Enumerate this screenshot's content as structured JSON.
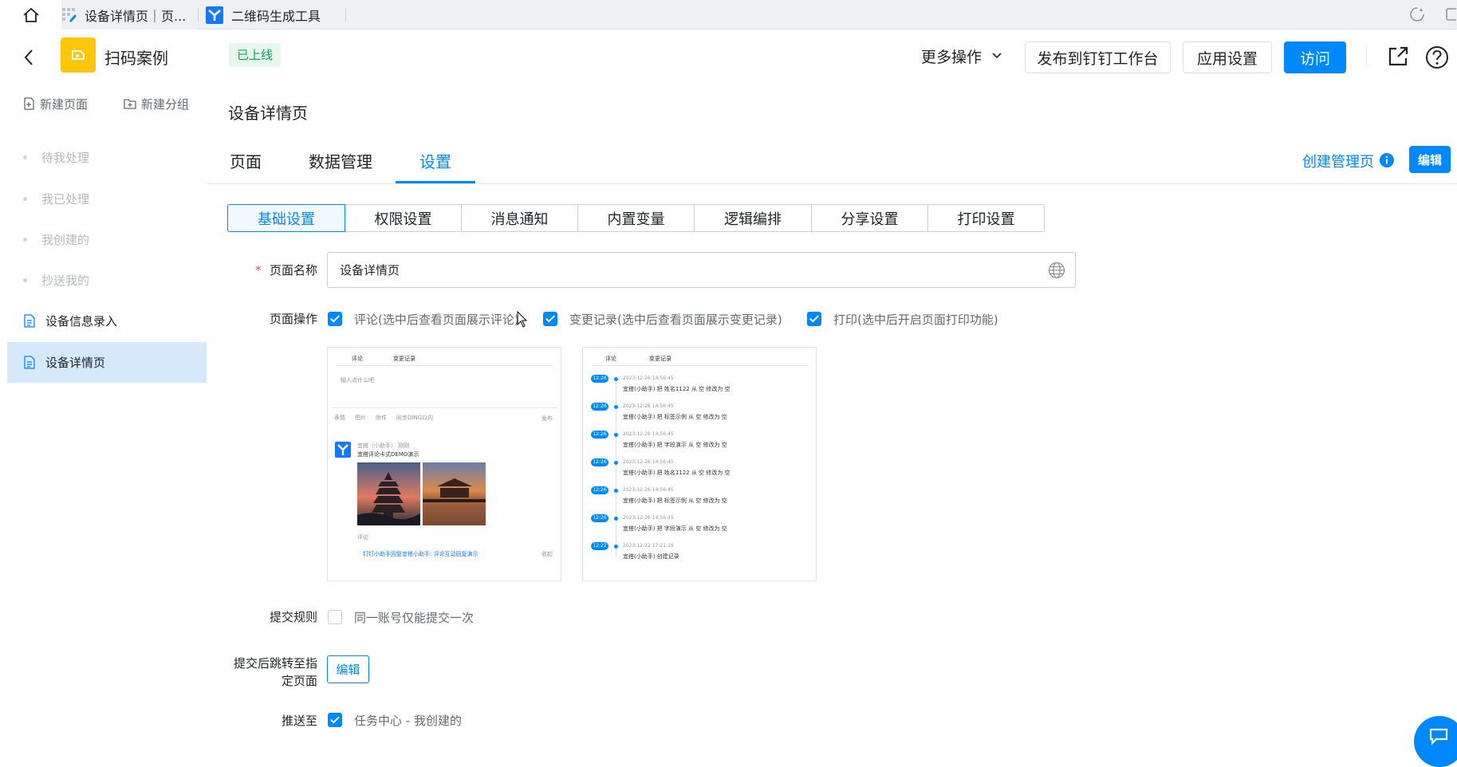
{
  "browser": {
    "tabs": [
      {
        "title": "设备详情页｜页..."
      },
      {
        "title": "二维码生成工具"
      }
    ]
  },
  "header": {
    "app_name": "扫码案例",
    "status_badge": "已上线",
    "more_actions": "更多操作",
    "publish_button": "发布到钉钉工作台",
    "app_settings_button": "应用设置",
    "visit_button": "访问"
  },
  "sidebar": {
    "new_page": "新建页面",
    "new_group": "新建分组",
    "items": [
      {
        "label": "待我处理",
        "style": "dim"
      },
      {
        "label": "我已处理",
        "style": "dim"
      },
      {
        "label": "我创建的",
        "style": "dim"
      },
      {
        "label": "抄送我的",
        "style": "dim"
      },
      {
        "label": "设备信息录入",
        "style": "doc"
      },
      {
        "label": "设备详情页",
        "style": "active"
      }
    ]
  },
  "page": {
    "title": "设备详情页",
    "main_tabs": [
      "页面",
      "数据管理",
      "设置"
    ],
    "active_main_tab": "设置",
    "create_admin_page": "创建管理页",
    "edit_button": "编辑"
  },
  "settings_tabs": [
    "基础设置",
    "权限设置",
    "消息通知",
    "内置变量",
    "逻辑编排",
    "分享设置",
    "打印设置"
  ],
  "active_settings_tab": "基础设置",
  "form": {
    "page_name_label": "页面名称",
    "page_name_value": "设备详情页",
    "page_ops_label": "页面操作",
    "page_ops": [
      {
        "label": "评论(选中后查看页面展示评论)",
        "checked": true
      },
      {
        "label": "变更记录(选中后查看页面展示变更记录)",
        "checked": true
      },
      {
        "label": "打印(选中后开启页面打印功能)",
        "checked": true
      }
    ],
    "submit_rule_label": "提交规则",
    "submit_rule_option": "同一账号仅能提交一次",
    "submit_rule_checked": false,
    "redirect_label_line1": "提交后跳转至指",
    "redirect_label_line2": "定页面",
    "redirect_button": "编辑",
    "push_label": "推送至",
    "push_option": "任务中心 - 我创建的",
    "push_checked": true
  },
  "comment_preview": {
    "tab_comment": "评论",
    "tab_changes": "变更记录",
    "placeholder": "输入点什么吧",
    "toolbar": [
      "表情",
      "图片",
      "附件",
      "同步DING以内"
    ],
    "send": "发布",
    "author": "宜搭（小助手） 刚刚",
    "post_title": "宜搭评论卡式DEMO演示",
    "reply_label": "评论",
    "reply_text": "钉钉小助手回复宜搭小助手: 评论互动回复演示",
    "reply_action": "收起"
  },
  "change_preview": {
    "tab_comment": "评论",
    "tab_changes": "变更记录",
    "entries": [
      {
        "time": "12:26",
        "date": "2023-12-26 14:56:45",
        "text": "宜搭(小助手) 把 姓名1122 从 空 修改为 空"
      },
      {
        "time": "12:26",
        "date": "2023-12-26 14:56:45",
        "text": "宜搭(小助手) 把 标签示例 从 空 修改为 空"
      },
      {
        "time": "12:26",
        "date": "2023-12-26 14:56:45",
        "text": "宜搭(小助手) 把 字段演示 从 空 修改为 空"
      },
      {
        "time": "12:26",
        "date": "2023-12-26 14:56:45",
        "text": "宜搭(小助手) 把 姓名1122 从 空 修改为 空"
      },
      {
        "time": "12:26",
        "date": "2023-12-26 14:56:45",
        "text": "宜搭(小助手) 把 标签示例 从 空 修改为 空"
      },
      {
        "time": "12:26",
        "date": "2023-12-26 14:56:45",
        "text": "宜搭(小助手) 把 字段演示 从 空 修改为 空"
      },
      {
        "time": "12:22",
        "date": "2023-12-22 17:21:19",
        "text": "宜搭(小助手) 创建记录"
      }
    ]
  },
  "colors": {
    "accent": "#0089ff",
    "badge_bg": "#e6f7ec",
    "badge_text": "#18a058",
    "app_icon": "#ffc60a"
  }
}
